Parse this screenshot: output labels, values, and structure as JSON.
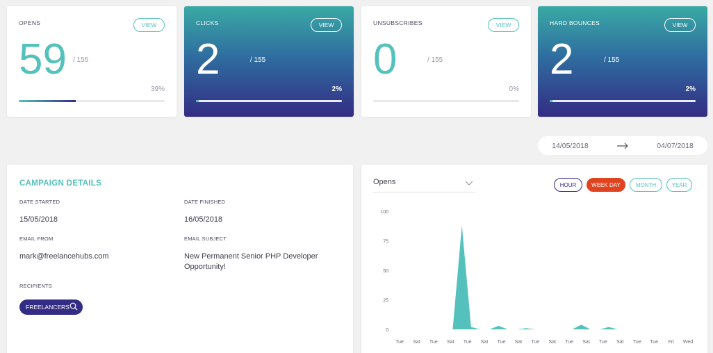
{
  "stats": [
    {
      "title": "OPENS",
      "view_label": "VIEW",
      "value": "59",
      "total": "/ 155",
      "percent": "39%",
      "fill": 0.39,
      "style": "light"
    },
    {
      "title": "CLICKS",
      "view_label": "VIEW",
      "value": "2",
      "total": "/ 155",
      "percent": "2%",
      "fill": 0.02,
      "style": "dark"
    },
    {
      "title": "UNSUBSCRIBES",
      "view_label": "VIEW",
      "value": "0",
      "total": "/ 155",
      "percent": "0%",
      "fill": 0.0,
      "style": "light"
    },
    {
      "title": "HARD BOUNCES",
      "view_label": "VIEW",
      "value": "2",
      "total": "/ 155",
      "percent": "2%",
      "fill": 0.02,
      "style": "dark"
    }
  ],
  "date_range": {
    "start": "14/05/2018",
    "end": "04/07/2018"
  },
  "campaign": {
    "title": "CAMPAIGN DETAILS",
    "date_started_label": "DATE STARTED",
    "date_started": "15/05/2018",
    "date_finished_label": "DATE FINISHED",
    "date_finished": "16/05/2018",
    "email_from_label": "EMAIL FROM",
    "email_from": "mark@freelancehubs.com",
    "email_subject_label": "EMAIL SUBJECT",
    "email_subject": "New Permanent Senior PHP Developer Opportunity!",
    "recipients_label": "RECIPIENTS",
    "recipient_chip": "FREELANCERS"
  },
  "chart_panel": {
    "metric_select": "Opens",
    "periods": {
      "hour": "HOUR",
      "week": "WEEK DAY",
      "month": "MONTH",
      "year": "YEAR"
    },
    "active_period": "WEEK DAY"
  },
  "colors": {
    "accent": "#55c1bc",
    "brand": "#332c84",
    "active": "#e0431f"
  },
  "chart_data": {
    "type": "area",
    "title": "",
    "xlabel": "",
    "ylabel": "",
    "ylim": [
      0,
      100
    ],
    "yticks": [
      0,
      25,
      50,
      75,
      100
    ],
    "categories": [
      "Tue",
      "Sat",
      "Tue",
      "Sat",
      "Tue",
      "Sat",
      "Tue",
      "Sat",
      "Tue",
      "Sat",
      "Tue",
      "Sat",
      "Tue",
      "Sat",
      "Tue",
      "Tue",
      "Fri",
      "Wed"
    ],
    "series": [
      {
        "values": [
          0,
          0,
          0,
          88,
          2,
          0,
          0,
          3,
          0,
          0,
          1,
          0,
          0,
          0,
          0,
          0,
          4,
          0,
          0,
          2,
          0,
          0,
          0,
          0,
          0,
          0,
          0,
          0,
          0
        ]
      }
    ]
  }
}
